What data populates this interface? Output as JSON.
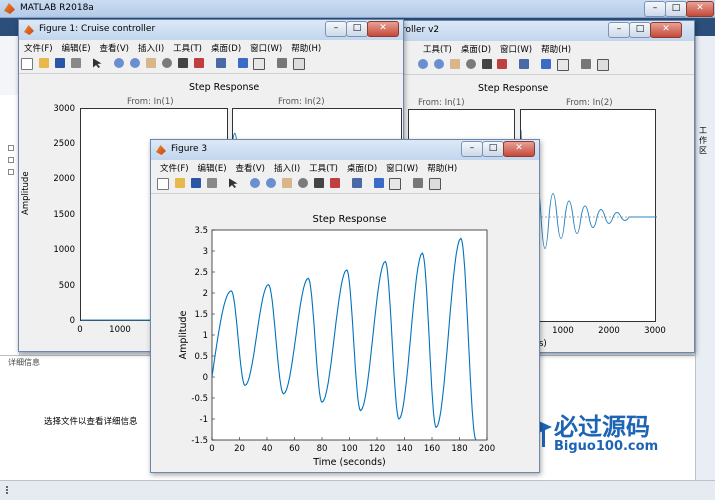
{
  "main_window": {
    "title": "MATLAB R2018a",
    "right_tab_label": "工作区",
    "detail_header": "详细信息",
    "detail_text": "选择文件以查看详细信息",
    "controls": {
      "minimize": "–",
      "maximize": "□",
      "close": "✕"
    }
  },
  "menu": [
    "文件(F)",
    "编辑(E)",
    "查看(V)",
    "插入(I)",
    "工具(T)",
    "桌面(D)",
    "窗口(W)",
    "帮助(H)"
  ],
  "fig1": {
    "title": "Figure 1: Cruise controller",
    "plot_title": "Step Response",
    "col1": "From: In(1)",
    "col2": "From: In(2)",
    "ylabel": "Amplitude",
    "yticks": [
      "3000",
      "2500",
      "2000",
      "1500",
      "1000",
      "500",
      "0"
    ],
    "xticks": [
      "0",
      "1000"
    ]
  },
  "fig2": {
    "title_partial": "roller v2",
    "plot_title": "Step Response",
    "col1": "From: In(1)",
    "col2": "From: In(2)",
    "xticks": [
      "0",
      "1000",
      "2000",
      "3000"
    ],
    "xlabel_partial": "s)"
  },
  "fig3": {
    "title": "Figure 3",
    "plot_title": "Step Response",
    "xlabel": "Time (seconds)",
    "ylabel": "Amplitude",
    "yticks": [
      "3.5",
      "3",
      "2.5",
      "2",
      "1.5",
      "1",
      "0.5",
      "0",
      "-0.5",
      "-1",
      "-1.5"
    ],
    "xticks": [
      "0",
      "20",
      "40",
      "60",
      "80",
      "100",
      "120",
      "140",
      "160",
      "180",
      "200"
    ]
  },
  "chart_data": [
    {
      "type": "line",
      "title": "Step Response",
      "xlabel": "Time (seconds)",
      "ylabel": "Amplitude",
      "xlim": [
        0,
        200
      ],
      "ylim": [
        -1.5,
        3.5
      ],
      "grid": false,
      "series": [
        {
          "x": [
            0,
            14,
            24,
            41,
            52,
            70,
            80,
            98,
            108,
            126,
            136,
            153,
            163,
            181,
            192
          ],
          "values": [
            0,
            2.05,
            -0.2,
            2.2,
            -0.4,
            2.35,
            -0.6,
            2.55,
            -0.8,
            2.75,
            -1.0,
            2.95,
            -1.2,
            3.3,
            -1.5
          ]
        }
      ],
      "color": "#0072bd"
    }
  ],
  "watermark": {
    "brand_cn": "必过源码",
    "brand_url": "Biguo100.com"
  }
}
